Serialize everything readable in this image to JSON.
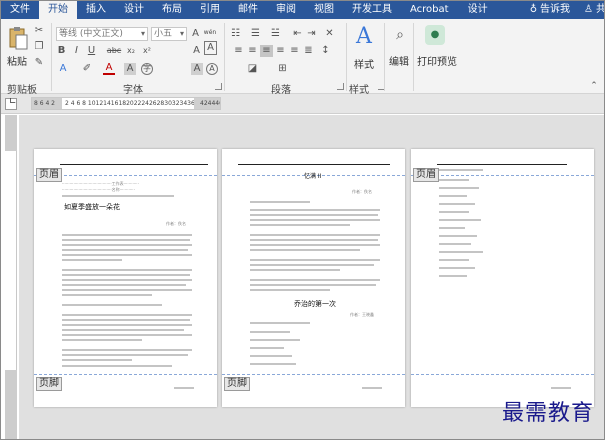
{
  "tabs": [
    "文件",
    "开始",
    "插入",
    "设计",
    "布局",
    "引用",
    "邮件",
    "审阅",
    "视图",
    "开发工具",
    "Acrobat",
    "设计"
  ],
  "tell_me": "告诉我",
  "share": "共",
  "ribbon": {
    "paste_label": "粘贴",
    "clipboard_label": "剪贴板",
    "font_name": "等线 (中文正文)",
    "font_size": "小五",
    "wen": "wén",
    "font_group_label": "字体",
    "paragraph_group_label": "段落",
    "style_button": "样式",
    "style_group_label": "样式",
    "edit_button": "编辑",
    "print_preview_button": "打印预览"
  },
  "ruler": {
    "left_numbers": "8 6 4 2",
    "right_numbers": "2 4 6 8 1012141618202224262830323436",
    "far_numbers": "424446"
  },
  "pages": [
    {
      "header_tag": "页眉",
      "footer_tag": "页脚",
      "top_line1": "·······································工作表············",
      "top_line2": "·······································名称············",
      "title": "如夏季盛放一朵花",
      "author": "作者：佚名"
    },
    {
      "header_tag": "",
      "footer_tag": "页脚",
      "title": "忆满 II",
      "author": "作者：佚名",
      "subtitle": "乔治的第一次",
      "subauthor": "作者：王晓鑫"
    },
    {
      "header_tag": "页眉",
      "footer_tag": ""
    }
  ],
  "watermark": "最需教育"
}
